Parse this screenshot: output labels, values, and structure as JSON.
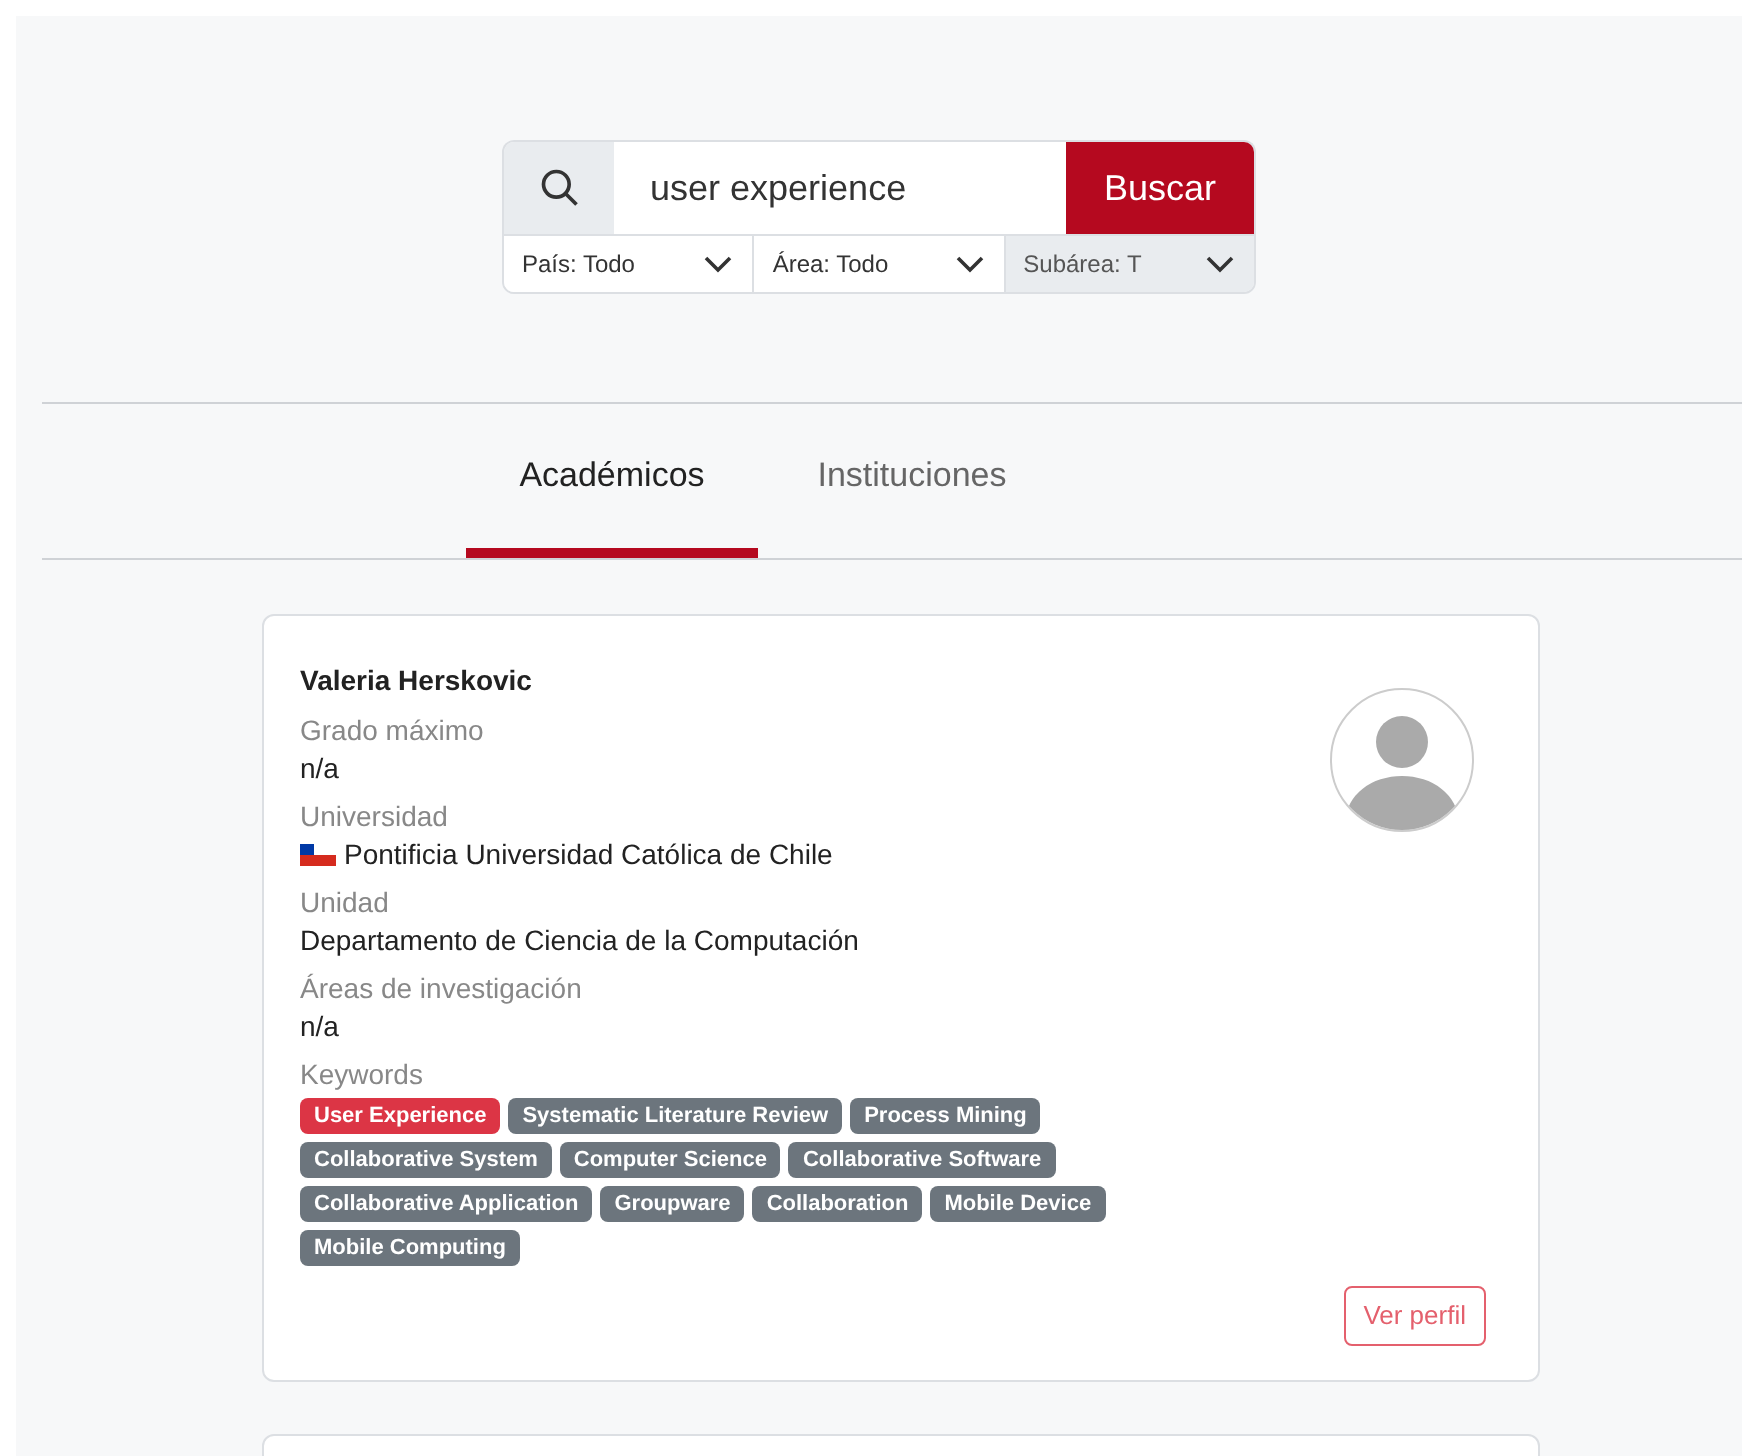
{
  "search": {
    "value": "user experience",
    "button": "Buscar"
  },
  "filters": [
    {
      "label": "País: Todo",
      "disabled": false
    },
    {
      "label": "Área: Todo",
      "disabled": false
    },
    {
      "label": "Subárea: T",
      "disabled": true
    }
  ],
  "tabs": [
    {
      "label": "Académicos",
      "selected": true
    },
    {
      "label": "Instituciones",
      "selected": false
    }
  ],
  "results": [
    {
      "name": "Valeria Herskovic",
      "fields": [
        {
          "label": "Grado máximo",
          "value": "n/a"
        },
        {
          "label": "Universidad",
          "value": "Pontificia Universidad Católica de Chile",
          "flag": true
        },
        {
          "label": "Unidad",
          "value": "Departamento de Ciencia de la Computación"
        },
        {
          "label": "Áreas de investigación",
          "value": "n/a"
        }
      ],
      "keywords_label": "Keywords",
      "keywords": [
        {
          "label": "User Experience",
          "matched": true
        },
        {
          "label": "Systematic Literature Review",
          "matched": false
        },
        {
          "label": "Process Mining",
          "matched": false
        },
        {
          "label": "Collaborative System",
          "matched": false
        },
        {
          "label": "Computer Science",
          "matched": false
        },
        {
          "label": "Collaborative Software",
          "matched": false
        },
        {
          "label": "Collaborative Application",
          "matched": false
        },
        {
          "label": "Groupware",
          "matched": false
        },
        {
          "label": "Collaboration",
          "matched": false
        },
        {
          "label": "Mobile Device",
          "matched": false
        },
        {
          "label": "Mobile Computing",
          "matched": false
        }
      ],
      "action": "Ver perfil"
    }
  ]
}
